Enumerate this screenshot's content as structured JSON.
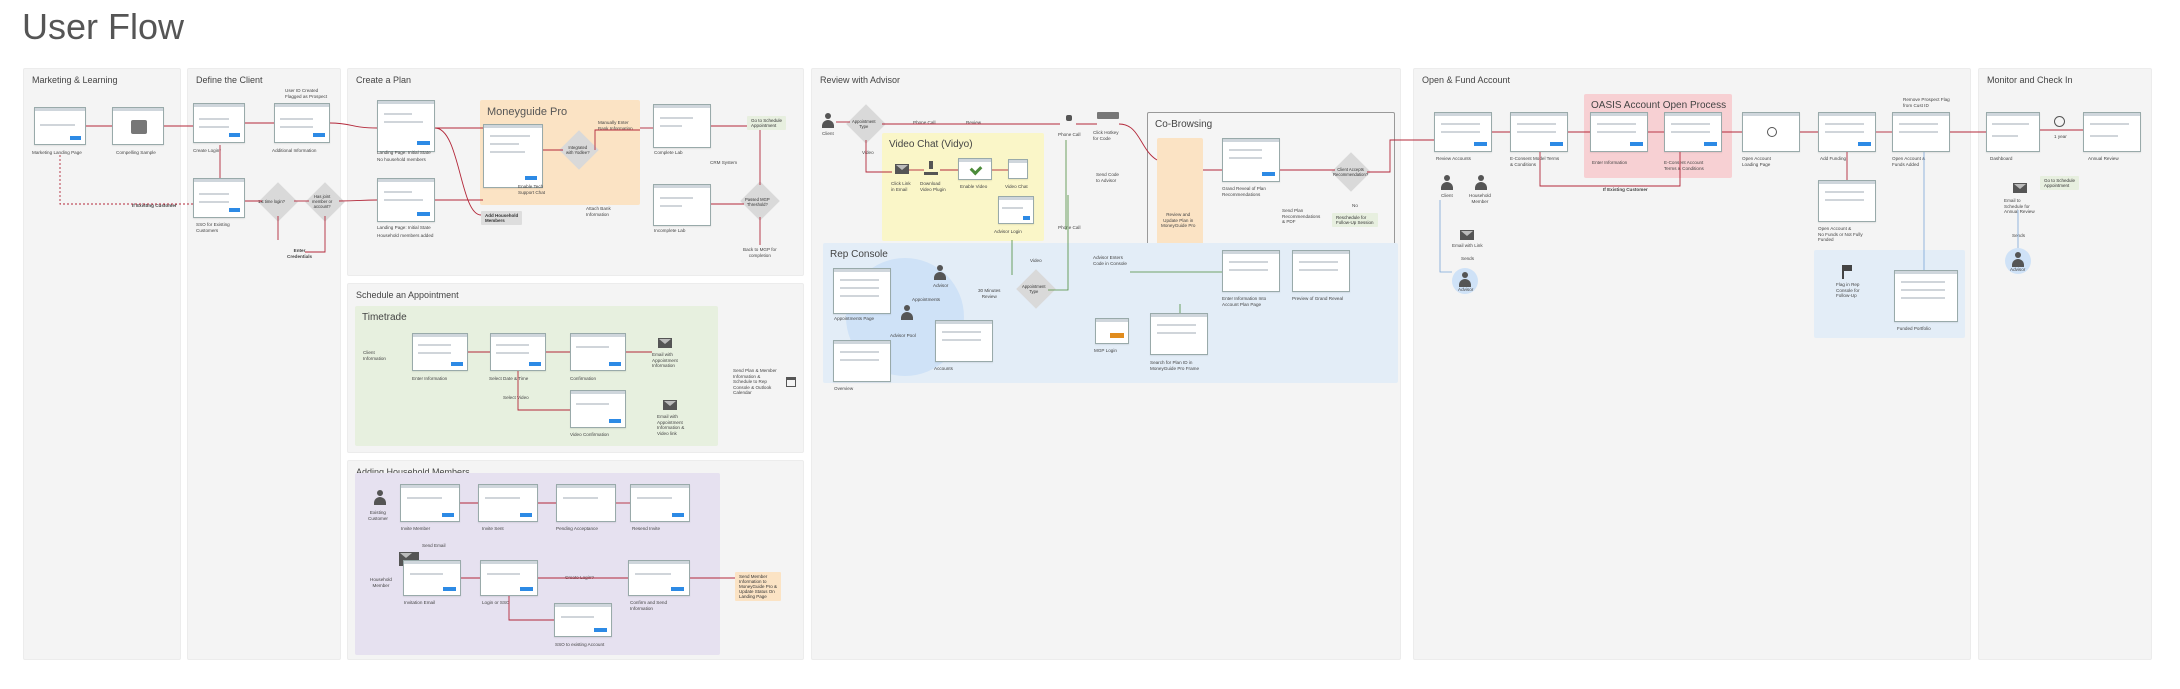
{
  "title": "User Flow",
  "sections": {
    "marketing": "Marketing & Learning",
    "define": "Define the Client",
    "plan": "Create a Plan",
    "schedule": "Schedule an Appointment",
    "household": "Adding Household Members",
    "review": "Review with Advisor",
    "open": "Open & Fund Account",
    "monitor": "Monitor and Check In"
  },
  "subsections": {
    "moneyguide": "Moneyguide Pro",
    "timetrade": "Timetrade",
    "video_chat": "Video Chat (Vidyo)",
    "co_browsing": "Co-Browsing",
    "rep_console": "Rep Console",
    "oasis": "OASIS Account Open Process"
  },
  "marketing": {
    "landing": "Marketing Landing Page",
    "sample": "Compelling Sample",
    "existing": "If Existing Customer"
  },
  "define": {
    "user_id": "User ID Created\nFlagged as Prospect",
    "create_login": "Create Login*",
    "additional": "Additional Information",
    "sso": "SSO for Existing\nCustomers",
    "first_login": "1st time login?",
    "has_joint": "Has joint\nmember or\naccount?",
    "enter_cred": "Enter\nCredentials",
    "yes": "Yes",
    "no": "No"
  },
  "plan": {
    "landing_initial": "Landing Page: Initial State",
    "no_household": "No household members",
    "landing_initial2": "Landing Page: Initial State",
    "household_added": "Household members added",
    "integrated": "Integrated\nwith Yodlee?",
    "manually": "Manually Enter\nBank Information",
    "attach_bank": "Attach Bank\nInformation",
    "enable_tech": "Enable Tech\nSupport Chat",
    "add_household": "Add Household\nMembers",
    "complete_lab": "Complete Lab",
    "crm": "CRM System",
    "incomplete_lab": "Incomplete Lab",
    "passed_mgp": "Passed MGP\nThreshold?",
    "go_schedule": "Go to Schedule\nAppointment",
    "back_mgp": "Back to MGP for\ncompletion"
  },
  "schedule": {
    "client_info": "Client\nInformation",
    "enter_info": "Enter Information",
    "select_date": "Select Date & Time",
    "confirmation": "Confirmation",
    "email_appt": "Email with\nAppointment\nInformation",
    "select_video": "Select Video",
    "video_confirm": "Video Confirmation",
    "email_video": "Email with\nAppointment\nInformation &\nVideo link",
    "send_plan": "Send Plan & Member\nInformation &\nSchedule to Rep\nConsole & Outlook\nCalendar"
  },
  "household": {
    "existing_customer": "Existing\nCustomer",
    "invite_member": "Invite Member",
    "invite_sent": "Invite Sent",
    "pending": "Pending Acceptance",
    "resend": "Resend Invite",
    "send_email": "Send Email",
    "household_member": "Household\nMember",
    "invitation_email": "Invitation Email",
    "login_sso": "Login or SSO",
    "create_login": "Create Login?",
    "confirm_send": "Confirm and Send\nInformation",
    "sso_existing": "SSO to existing Account",
    "send_member": "Send Member\nInformation to\nMoneyGuide Pro &\nUpdate Status On\nLanding Page"
  },
  "review": {
    "client": "Client",
    "appt_type": "Appointment\nType",
    "phone_call": "Phone Call",
    "review_lbl": "Review",
    "video": "Video",
    "click_link": "Click Link\nin Email",
    "download": "Download\nVideo Plugin",
    "enable_video": "Enable Video",
    "video_chat": "Video Chat",
    "advisor": "Advisor",
    "advisor_login": "Advisor Login",
    "phone_call2": "Phone Call",
    "click_hotkey": "Click Hotkey\nfor Code",
    "send_code": "Send Code\nto Advisor",
    "advisor_enters": "Advisor Enters\nCode in Console",
    "review_update": "Review and\nUpdate Plan in\nMoneyGuide Pro",
    "grand_reveal": "Grand Reveal of Plan\nRecommendations",
    "client_accepts": "Client Accepts\nRecommendation?",
    "send_plan_rec": "Send Plan\nRecommendations\n& PDF",
    "reschedule": "Reschedule for\nFollow-Up Session",
    "enter_info": "Enter Information Into\nAccount Plan Page",
    "preview": "Preview of Grand Reveal",
    "mgp_login": "MGP Login",
    "search_plan": "Search for Plan ID in\nMoneyGuide Pro Frame",
    "appointments": "Appointments",
    "appt_page": "Appointments Page",
    "advisor_pool": "Advisor Pool",
    "min30": "30 Minutes\nReview",
    "accounts": "Accounts",
    "overview": "Overview",
    "video_lbl": "Video",
    "yes": "Yes",
    "no": "No"
  },
  "open": {
    "review_accounts": "Review Accounts",
    "model_terms": "E-Consent Model Terms\n& Conditions",
    "enter_info": "Enter Information",
    "account_terms": "E-Consent Account\nTerms & Conditions",
    "loading": "Open Account\nLoading Page",
    "add_funding": "Add Funding",
    "open_funds": "Open Account &\nFunds Added",
    "remove_flag": "Remove Prospect Flag\nfrom Cust ID",
    "if_existing": "If Existing Customer",
    "client": "Client",
    "household_member": "Household\nMember",
    "email_link": "Email with Link",
    "sends": "Sends",
    "advisor": "Advisor",
    "open_no_funds": "Open Account &\nNo Funds or Not Fully\nFunded",
    "flag_rep": "Flag in Rep\nConsole for\nFollow-Up",
    "funded_portfolio": "Funded Portfolio"
  },
  "monitor": {
    "dashboard": "Dashboard",
    "annual": "Annual Review",
    "email_schedule": "Email to\nSchedule for\nAnnual Review",
    "go_schedule": "Go to Schedule\nAppointment",
    "sends": "Sends",
    "advisor": "Advisor",
    "year": "1 year"
  }
}
